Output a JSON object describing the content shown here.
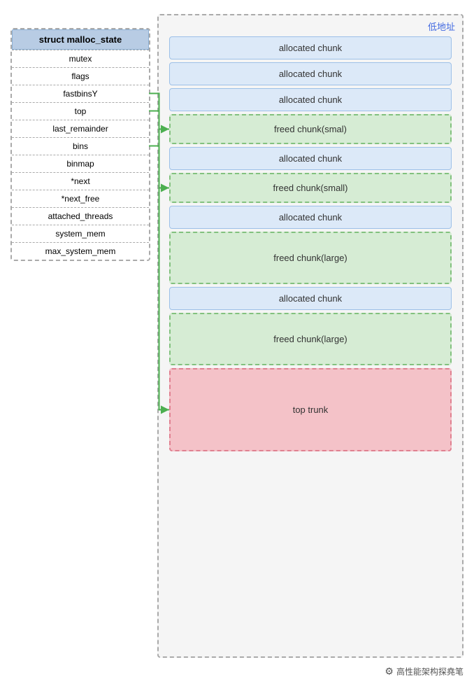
{
  "struct": {
    "title": "struct malloc_state",
    "fields": [
      "mutex",
      "flags",
      "fastbinsY",
      "top",
      "last_remainder",
      "bins",
      "binmap",
      "*next",
      "*next_free",
      "attached_threads",
      "system_mem",
      "max_system_mem"
    ]
  },
  "labels": {
    "low_address": "低地址"
  },
  "chunks": [
    {
      "id": "chunk1",
      "type": "allocated",
      "label": "allocated chunk"
    },
    {
      "id": "chunk2",
      "type": "allocated",
      "label": "allocated chunk"
    },
    {
      "id": "chunk3",
      "type": "allocated",
      "label": "allocated chunk"
    },
    {
      "id": "chunk4",
      "type": "freed-small",
      "label": "freed chunk(smal)"
    },
    {
      "id": "chunk5",
      "type": "allocated",
      "label": "allocated chunk"
    },
    {
      "id": "chunk6",
      "type": "freed-small",
      "label": "freed chunk(small)"
    },
    {
      "id": "chunk7",
      "type": "allocated",
      "label": "allocated chunk"
    },
    {
      "id": "chunk8",
      "type": "freed-large",
      "label": "freed chunk(large)"
    },
    {
      "id": "chunk9",
      "type": "allocated",
      "label": "allocated chunk"
    },
    {
      "id": "chunk10",
      "type": "freed-large",
      "label": "freed chunk(large)"
    },
    {
      "id": "chunk11",
      "type": "top",
      "label": "top trunk"
    }
  ],
  "footer": {
    "icon": "⚙",
    "text": "高性能架构探堯笔"
  },
  "connections": [
    {
      "from_field": "fastbinsY",
      "to_chunk": "chunk4",
      "color": "#4caf50"
    },
    {
      "from_field": "bins",
      "to_chunk": "chunk6",
      "color": "#4caf50"
    },
    {
      "from_field": "top",
      "to_chunk": "chunk11",
      "color": "#4caf50"
    }
  ]
}
